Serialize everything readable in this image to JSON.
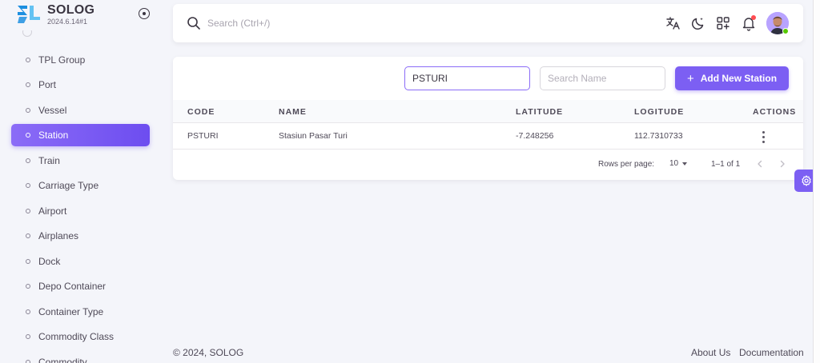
{
  "brand": {
    "name": "SOLOG",
    "version": "2024.6.14#1",
    "logo_colors": [
      "#1d8fe0",
      "#63c2f2"
    ]
  },
  "sidebar": {
    "items": [
      {
        "label": "TPL Group",
        "active": false
      },
      {
        "label": "Port",
        "active": false
      },
      {
        "label": "Vessel",
        "active": false
      },
      {
        "label": "Station",
        "active": true
      },
      {
        "label": "Train",
        "active": false
      },
      {
        "label": "Carriage Type",
        "active": false
      },
      {
        "label": "Airport",
        "active": false
      },
      {
        "label": "Airplanes",
        "active": false
      },
      {
        "label": "Dock",
        "active": false
      },
      {
        "label": "Depo Container",
        "active": false
      },
      {
        "label": "Container Type",
        "active": false
      },
      {
        "label": "Commodity Class",
        "active": false
      },
      {
        "label": "Commodity",
        "active": false
      }
    ]
  },
  "topbar": {
    "search_placeholder": "Search (Ctrl+/)",
    "icons": [
      "translate-icon",
      "theme-toggle-icon",
      "shortcuts-icon",
      "notification-bell-icon",
      "user-avatar"
    ]
  },
  "filters": {
    "code_value": "PSTURI",
    "name_placeholder": "Search Name",
    "add_button_label": "Add New Station"
  },
  "table": {
    "columns": [
      "CODE",
      "NAME",
      "LATITUDE",
      "LOGITUDE",
      "ACTIONS"
    ],
    "rows": [
      {
        "code": "PSTURI",
        "name": "Stasiun Pasar Turi",
        "latitude": "-7.248256",
        "longitude": "112.7310733"
      }
    ]
  },
  "pagination": {
    "rows_per_page_label": "Rows per page:",
    "rows_per_page_value": "10",
    "range_text": "1–1 of 1"
  },
  "footer": {
    "copyright": "© 2024, SOLOG",
    "links": [
      "About Us",
      "Documentation"
    ]
  },
  "colors": {
    "primary": "#7c5ff3",
    "background": "#f4f5fa",
    "text": "#3a3541",
    "online": "#56ca00",
    "notification": "#ff4c51"
  }
}
